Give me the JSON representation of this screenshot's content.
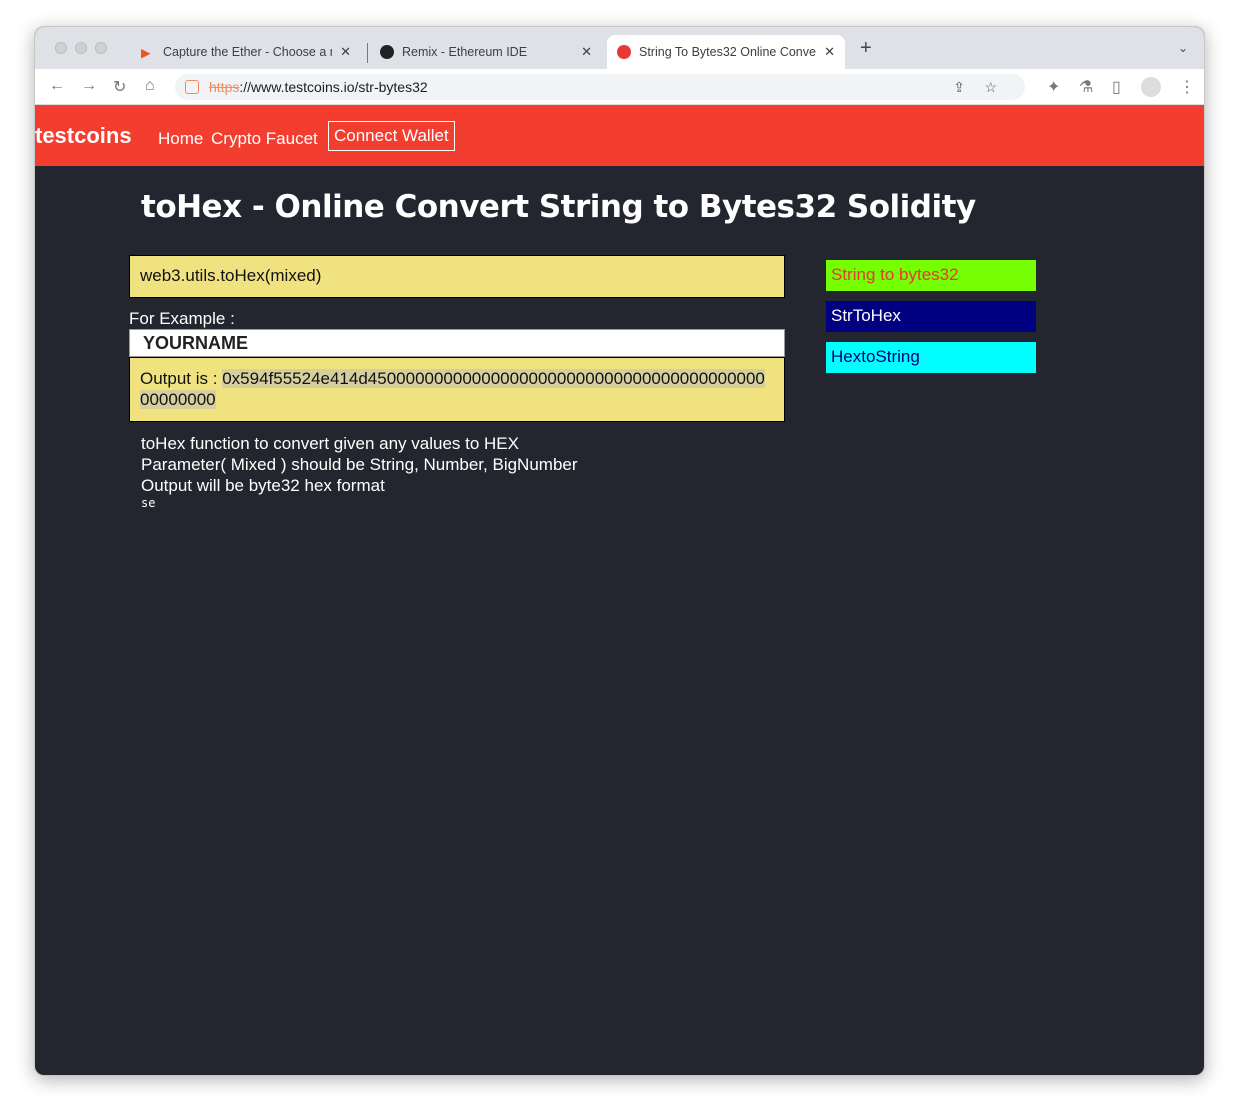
{
  "browser": {
    "tabs": [
      {
        "title": "Capture the Ether - Choose a n",
        "icon": "flag-icon"
      },
      {
        "title": "Remix - Ethereum IDE",
        "icon": "remix-icon"
      },
      {
        "title": "String To Bytes32 Online Conve",
        "icon": "testcoins-icon",
        "active": true
      }
    ],
    "url_scheme": "https",
    "url_rest": "://www.testcoins.io/str-bytes32"
  },
  "nav": {
    "brand": "testcoins",
    "home": "Home",
    "faucet": "Crypto Faucet",
    "connect": "Connect Wallet"
  },
  "main": {
    "title": "toHex - Online Convert String to Bytes32 Solidity",
    "function": "web3.utils.toHex(mixed)",
    "example_label": "For Example :",
    "input_value": "YOURNAME",
    "output_label": "Output is : ",
    "output_value": "0x594f55524e414d45000000000000000000000000000000000000000000000000",
    "desc": [
      "toHex function to convert given any values to HEX",
      "Parameter( Mixed ) should be String, Number, BigNumber",
      "Output will be byte32 hex format"
    ],
    "small": "se"
  },
  "sidebar": [
    {
      "label": "String to bytes32",
      "bg": "#76ff03",
      "color": "#e53935"
    },
    {
      "label": "StrToHex",
      "bg": "#000080",
      "color": "#ffffff"
    },
    {
      "label": "HextoString",
      "bg": "#00ffff",
      "color": "#000080"
    }
  ]
}
